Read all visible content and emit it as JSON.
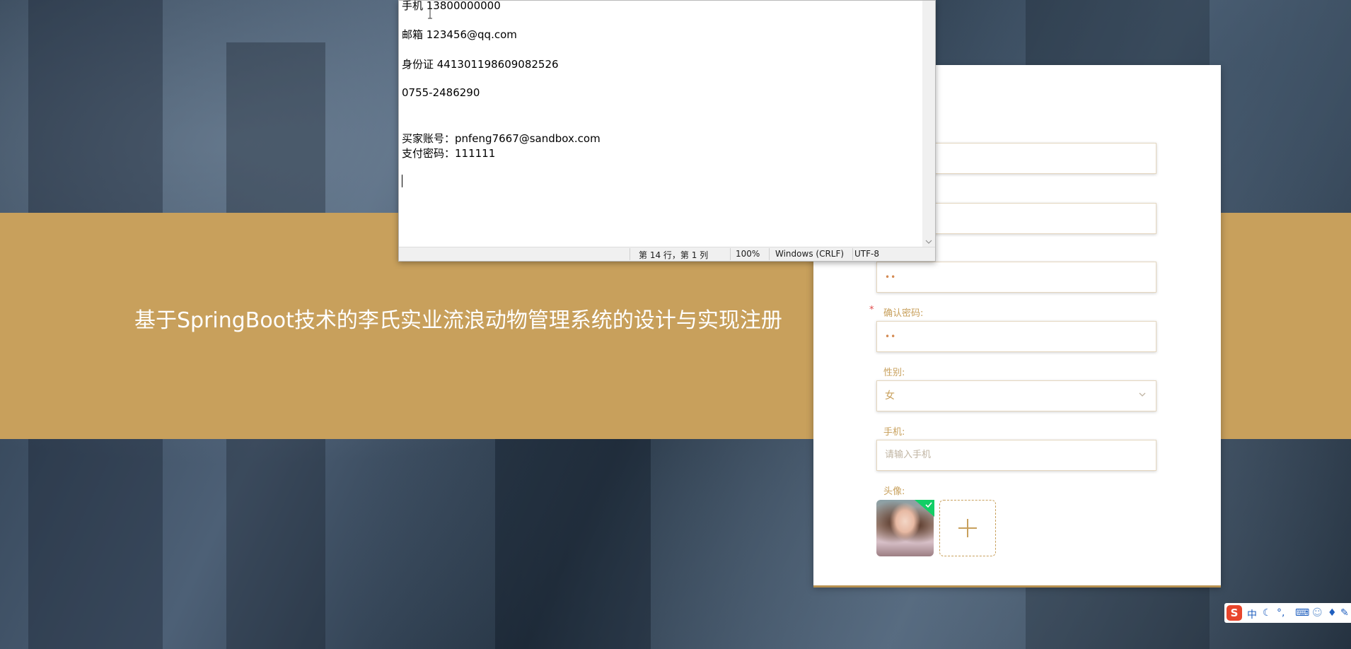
{
  "page": {
    "title": "基于SpringBoot技术的李氏实业流浪动物管理系统的设计与实现注册"
  },
  "form": {
    "password_value": "••",
    "confirm_password": {
      "label": "确认密码:",
      "value": "••"
    },
    "gender": {
      "label": "性别:",
      "value": "女"
    },
    "phone": {
      "label": "手机:",
      "placeholder": "请输入手机"
    },
    "avatar": {
      "label": "头像:"
    },
    "required_mark": "*"
  },
  "notepad": {
    "lines": [
      "手机 13800000000",
      "邮箱 123456@qq.com",
      "身份证 441301198609082526",
      "0755-2486290",
      "买家账号：pnfeng7667@sandbox.com",
      "支付密码：111111"
    ],
    "status": {
      "position": "第 14 行，第 1 列",
      "zoom": "100%",
      "line_ending": "Windows (CRLF)",
      "encoding": "UTF-8"
    }
  },
  "ime": {
    "logo": "S",
    "mode": "中"
  },
  "colors": {
    "accent": "#c8a05c",
    "required": "#e14b4b",
    "success": "#13ce66"
  }
}
